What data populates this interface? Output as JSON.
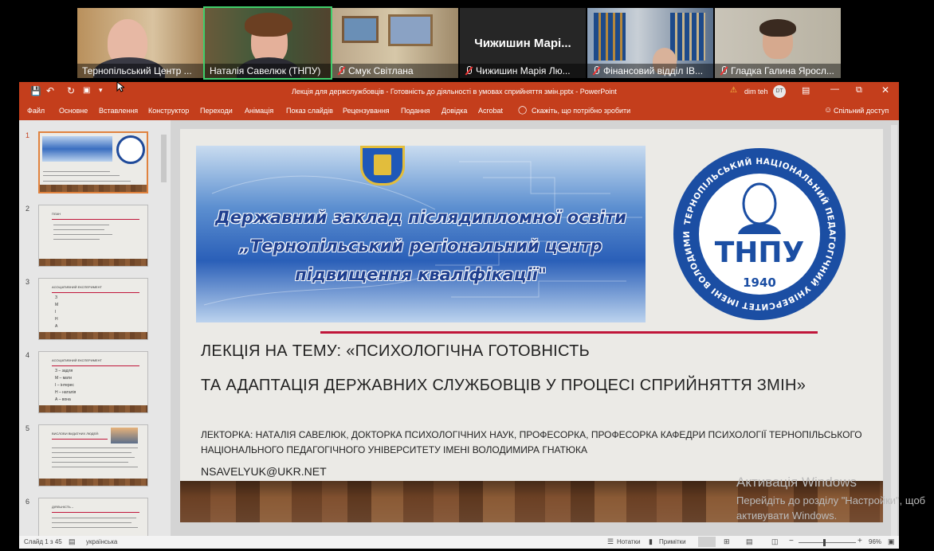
{
  "participants": [
    {
      "name": "Тернопільський Центр ...",
      "muted": false
    },
    {
      "name": "Наталія Савелюк (ТНПУ)",
      "muted": false,
      "active": true
    },
    {
      "name": "Смук Світлана",
      "muted": true
    },
    {
      "name": "Чижишин Марія Лю...",
      "muted": true,
      "display_text": "Чижишин  Марі..."
    },
    {
      "name": "Фінансовий відділ ІВ...",
      "muted": true
    },
    {
      "name": "Гладка Галина Яросл...",
      "muted": true
    }
  ],
  "window": {
    "title": "Лекція для держслужбовців - Готовність до діяльності в умовах сприйняття змін.pptx  -  PowerPoint",
    "user": "dim teh",
    "user_initials": "DT"
  },
  "ribbon": {
    "tabs": [
      "Файл",
      "Основне",
      "Вставлення",
      "Конструктор",
      "Переходи",
      "Анімація",
      "Показ слайдів",
      "Рецензування",
      "Подання",
      "Довідка",
      "Acrobat"
    ],
    "tell_me": "Скажіть, що потрібно зробити",
    "share": "Спільний доступ"
  },
  "thumbnails": [
    {
      "num": "1",
      "selected": true
    },
    {
      "num": "2",
      "title": "ПЛАН"
    },
    {
      "num": "3",
      "title": "АСОЦІАТИВНИЙ ЕКСПЕРИМЕНТ",
      "items": [
        "З",
        "М",
        "І",
        "Н",
        "А"
      ]
    },
    {
      "num": "4",
      "title": "АСОЦІАТИВНИЙ ЕКСПЕРИМЕНТ",
      "items": [
        "З – задля",
        "М – мати",
        "І – інтерес",
        "Н – наталія",
        "А – вона"
      ]
    },
    {
      "num": "5",
      "title": "ВИСЛОВИ ВИДАТНИХ ЛЮДЕЙ:"
    },
    {
      "num": "6",
      "title": "ДІЯЛЬНІСТЬ –"
    }
  ],
  "slide": {
    "banner_line1": "Державний заклад післядипломної освіти",
    "banner_line2": "„Тернопільський регіональний центр",
    "banner_line3": "підвищення кваліфікації\"",
    "logo_text": "ТНПУ",
    "logo_year": "1940",
    "logo_ring": "ТЕРНОПІЛЬСЬКИЙ НАЦІОНАЛЬНИЙ ПЕДАГОГІЧНИЙ УНІВЕРСИТЕТ ІМЕНІ ВОЛОДИМИРА ГНАТЮКА",
    "title_line1": "ЛЕКЦІЯ НА ТЕМУ: «ПСИХОЛОГІЧНА ГОТОВНІСТЬ",
    "title_line2": "ТА АДАПТАЦІЯ ДЕРЖАВНИХ СЛУЖБОВЦІВ У ПРОЦЕСІ СПРИЙНЯТТЯ ЗМІН»",
    "lecturer_line1": "ЛЕКТОРКА: НАТАЛІЯ САВЕЛЮК, ДОКТОРКА ПСИХОЛОГІЧНИХ НАУК, ПРОФЕСОРКА, ПРОФЕСОРКА КАФЕДРИ ПСИХОЛОГІЇ ТЕРНОПІЛЬСЬКОГО",
    "lecturer_line2": "НАЦІОНАЛЬНОГО ПЕДАГОГІЧНОГО УНІВЕРСИТЕТУ ІМЕНІ ВОЛОДИМИРА ГНАТЮКА",
    "email": "NSAVELYUK@UKR.NET"
  },
  "status": {
    "slide_info": "Слайд 1 з 45",
    "language": "українська",
    "notes": "Нотатки",
    "comments": "Примітки",
    "zoom": "96%"
  },
  "activation": {
    "title": "Активація Windows",
    "line1": "Перейдіть до розділу \"Настройки\", щоб",
    "line2": "активувати Windows."
  },
  "colors": {
    "ppt_accent": "#c43e1c",
    "active_speaker": "#3fcf6b",
    "slide_rule": "#c0163a"
  }
}
